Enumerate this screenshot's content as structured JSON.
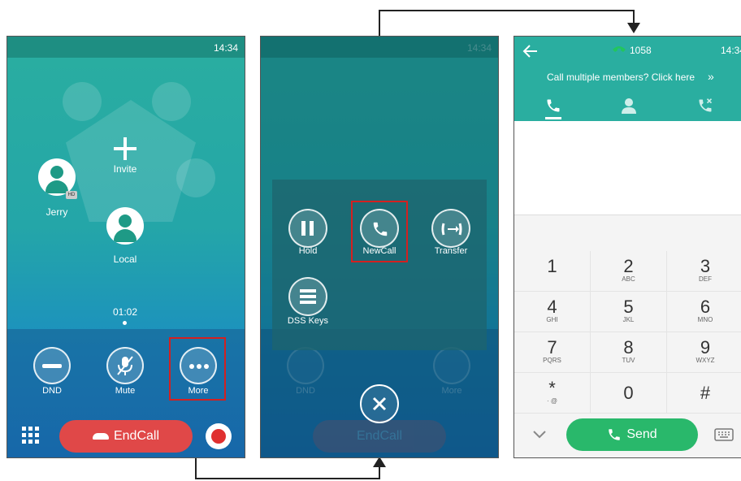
{
  "screen1": {
    "time": "14:34",
    "invite_label": "Invite",
    "participants": [
      {
        "name": "Jerry"
      },
      {
        "name": "Local"
      }
    ],
    "hd_badge": "HD",
    "timer": "01:02",
    "buttons": {
      "dnd": "DND",
      "mute": "Mute",
      "more": "More"
    },
    "endcall_label": "EndCall"
  },
  "screen2": {
    "time": "14:34",
    "menu": {
      "hold": "Hold",
      "newcall": "NewCall",
      "transfer": "Transfer",
      "dss_keys": "DSS Keys"
    },
    "faded_buttons": {
      "dnd": "DND",
      "more": "More"
    },
    "endcall_label": "EndCall"
  },
  "screen3": {
    "line_number": "1058",
    "time": "14:34",
    "banner": "Call multiple members? Click here",
    "banner_chevron": "»",
    "tabs": [
      "phone-icon",
      "contact-icon",
      "history-icon"
    ],
    "keys": [
      {
        "digit": "1",
        "letters": ""
      },
      {
        "digit": "2",
        "letters": "ABC"
      },
      {
        "digit": "3",
        "letters": "DEF"
      },
      {
        "digit": "4",
        "letters": "GHI"
      },
      {
        "digit": "5",
        "letters": "JKL"
      },
      {
        "digit": "6",
        "letters": "MNO"
      },
      {
        "digit": "7",
        "letters": "PQRS"
      },
      {
        "digit": "8",
        "letters": "TUV"
      },
      {
        "digit": "9",
        "letters": "WXYZ"
      },
      {
        "digit": "*",
        "letters": "· @"
      },
      {
        "digit": "0",
        "letters": ""
      },
      {
        "digit": "#",
        "letters": ""
      }
    ],
    "send_label": "Send"
  },
  "colors": {
    "teal": "#2aaea0",
    "blue": "#1a7fc4",
    "endcall_red": "#e04848",
    "send_green": "#29b86b",
    "highlight_red": "#d42020"
  }
}
